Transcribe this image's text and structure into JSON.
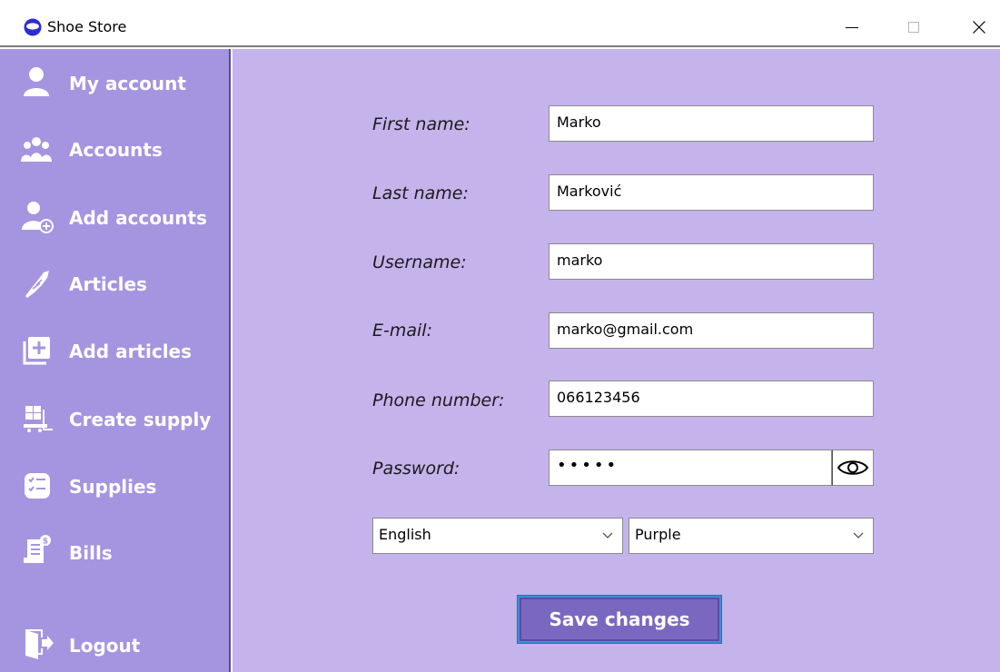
{
  "window": {
    "title": "Shoe Store",
    "minimize_icon": "minimize-icon",
    "maximize_icon": "maximize-icon",
    "close_icon": "close-icon"
  },
  "sidebar": {
    "items": [
      {
        "label": "My account",
        "icon": "user-icon"
      },
      {
        "label": "Accounts",
        "icon": "users-group-icon"
      },
      {
        "label": "Add accounts",
        "icon": "add-user-icon"
      },
      {
        "label": "Articles",
        "icon": "shoe-icon"
      },
      {
        "label": "Add articles",
        "icon": "add-box-icon"
      },
      {
        "label": "Create supply",
        "icon": "supply-cart-icon"
      },
      {
        "label": "Supplies",
        "icon": "checklist-icon"
      },
      {
        "label": "Bills",
        "icon": "bill-icon"
      },
      {
        "label": "Logout",
        "icon": "logout-icon"
      }
    ]
  },
  "form": {
    "first_name": {
      "label": "First name:",
      "value": "Marko"
    },
    "last_name": {
      "label": "Last name:",
      "value": "Marković"
    },
    "username": {
      "label": "Username:",
      "value": "marko"
    },
    "email": {
      "label": "E-mail:",
      "value": "marko@gmail.com"
    },
    "phone": {
      "label": "Phone number:",
      "value": "066123456"
    },
    "password": {
      "label": "Password:",
      "value": "•••••",
      "toggle_icon": "eye-icon"
    },
    "language": {
      "selected": "English"
    },
    "theme": {
      "selected": "Purple"
    },
    "save_label": "Save changes"
  },
  "colors": {
    "sidebar_bg": "#a594e0",
    "main_bg": "#c5b3ec",
    "button_bg": "#7a68c0",
    "button_focus": "#3c8fd8"
  }
}
